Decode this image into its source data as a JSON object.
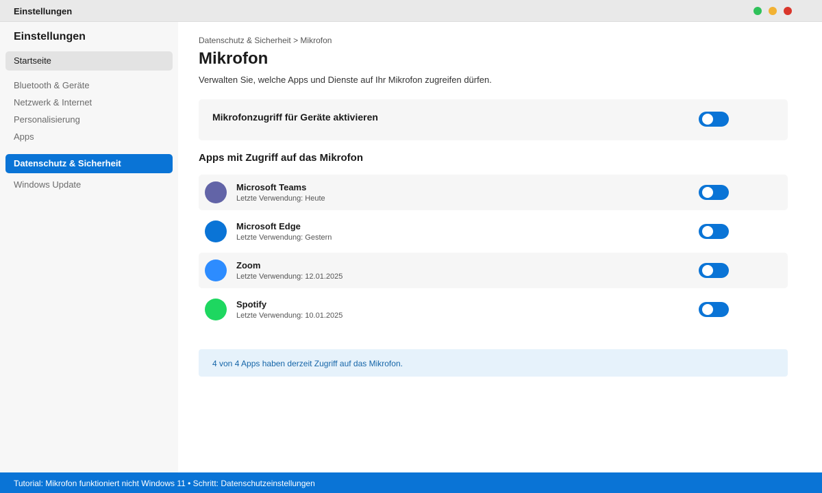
{
  "window": {
    "title": "Einstellungen",
    "controls": [
      {
        "name": "maximize",
        "color": "#2fc15a"
      },
      {
        "name": "minimize",
        "color": "#f2b233"
      },
      {
        "name": "close",
        "color": "#d9362b"
      }
    ]
  },
  "sidebar": {
    "title": "Einstellungen",
    "items": [
      {
        "label": "Startseite",
        "state": "home"
      },
      {
        "label": "Bluetooth & Geräte",
        "state": "normal"
      },
      {
        "label": "Netzwerk & Internet",
        "state": "normal"
      },
      {
        "label": "Personalisierung",
        "state": "normal"
      },
      {
        "label": "Apps",
        "state": "normal"
      },
      {
        "label": "Datenschutz & Sicherheit",
        "state": "active"
      },
      {
        "label": "Windows Update",
        "state": "normal"
      }
    ]
  },
  "main": {
    "breadcrumb": "Datenschutz & Sicherheit > Mikrofon",
    "title": "Mikrofon",
    "description": "Verwalten Sie, welche Apps und Dienste auf Ihr Mikrofon zugreifen dürfen.",
    "master_toggle": {
      "label": "Mikrofonzugriff für Geräte aktivieren",
      "on": true
    },
    "section_title": "Apps mit Zugriff auf das Mikrofon",
    "apps": [
      {
        "name": "Microsoft Teams",
        "last_used": "Letzte Verwendung: Heute",
        "icon": "microsoft-teams-icon",
        "icon_color": "#6264a7",
        "on": true
      },
      {
        "name": "Microsoft Edge",
        "last_used": "Letzte Verwendung: Gestern",
        "icon": "microsoft-edge-icon",
        "icon_color": "#0a74d6",
        "on": true
      },
      {
        "name": "Zoom",
        "last_used": "Letzte Verwendung: 12.01.2025",
        "icon": "zoom-icon",
        "icon_color": "#2d8cff",
        "on": true
      },
      {
        "name": "Spotify",
        "last_used": "Letzte Verwendung: 10.01.2025",
        "icon": "spotify-icon",
        "icon_color": "#1ed760",
        "on": true
      }
    ],
    "info_text": "4 von 4 Apps haben derzeit Zugriff auf das Mikrofon."
  },
  "footer": {
    "text": "Tutorial: Mikrofon funktioniert nicht Windows 11 • Schritt: Datenschutzeinstellungen"
  },
  "colors": {
    "accent": "#0a74d6",
    "info_background": "#e6f2fb"
  }
}
